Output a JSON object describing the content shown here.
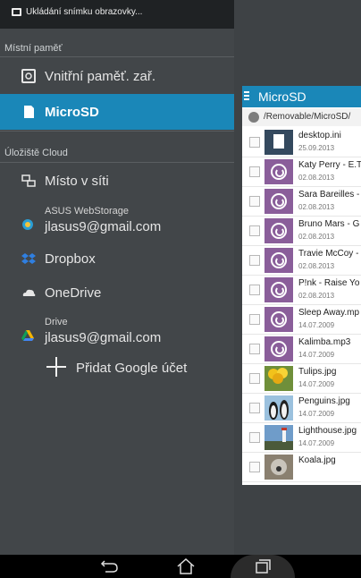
{
  "status_bar": {
    "notification": "Ukládání snímku obrazovky..."
  },
  "drawer": {
    "local_header": "Místní paměť",
    "local_items": [
      {
        "label": "Vnitřní paměť. zař.",
        "icon": "device-storage-icon",
        "active": false
      },
      {
        "label": "MicroSD",
        "icon": "sd-card-icon",
        "active": true
      }
    ],
    "cloud_header": "Úložiště Cloud",
    "network": {
      "label": "Místo v síti",
      "icon": "network-icon"
    },
    "asus": {
      "service": "ASUS WebStorage",
      "account": "jlasus9@gmail.com",
      "icon": "asus-webstorage-icon"
    },
    "dropbox": {
      "label": "Dropbox",
      "icon": "dropbox-icon"
    },
    "onedrive": {
      "label": "OneDrive",
      "icon": "onedrive-icon"
    },
    "drive": {
      "service": "Drive",
      "account": "jlasus9@gmail.com",
      "icon": "google-drive-icon"
    },
    "add_account": "Přidat Google účet"
  },
  "file_panel": {
    "title": "MicroSD",
    "path": "/Removable/MicroSD/",
    "files": [
      {
        "name": "desktop.ini",
        "date": "25.09.2013",
        "kind": "doc"
      },
      {
        "name": "Katy Perry - E.T",
        "date": "02.08.2013",
        "kind": "mp3"
      },
      {
        "name": "Sara Bareilles -",
        "date": "02.08.2013",
        "kind": "mp3"
      },
      {
        "name": "Bruno Mars - G",
        "date": "02.08.2013",
        "kind": "mp3"
      },
      {
        "name": "Travie McCoy -",
        "date": "02.08.2013",
        "kind": "mp3"
      },
      {
        "name": "P!nk - Raise Yo",
        "date": "02.08.2013",
        "kind": "mp3"
      },
      {
        "name": "Sleep Away.mp",
        "date": "14.07.2009",
        "kind": "mp3"
      },
      {
        "name": "Kalimba.mp3",
        "date": "14.07.2009",
        "kind": "mp3"
      },
      {
        "name": "Tulips.jpg",
        "date": "14.07.2009",
        "kind": "tulips"
      },
      {
        "name": "Penguins.jpg",
        "date": "14.07.2009",
        "kind": "penguins"
      },
      {
        "name": "Lighthouse.jpg",
        "date": "14.07.2009",
        "kind": "lighthouse"
      },
      {
        "name": "Koala.jpg",
        "date": "",
        "kind": "koala"
      }
    ]
  },
  "nav_bar": {
    "back": "back-icon",
    "home": "home-icon",
    "recent": "recent-apps-icon"
  },
  "colors": {
    "accent": "#1a87b8",
    "drawer_bg": "#424649",
    "status_bg": "#1f2224"
  }
}
